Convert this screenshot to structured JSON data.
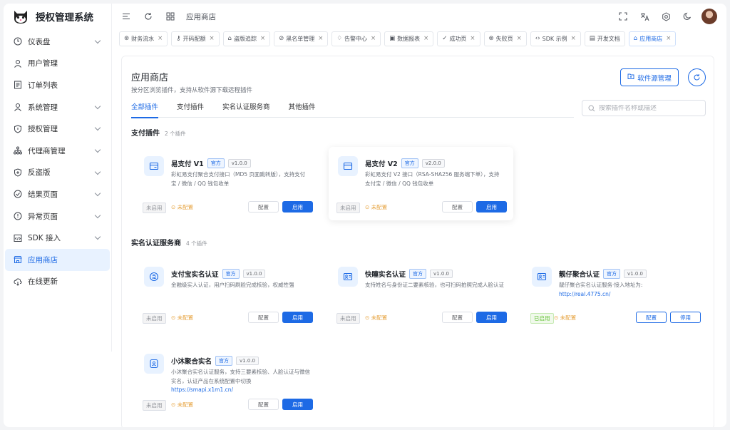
{
  "app": {
    "title": "授权管理系统"
  },
  "sidebar": {
    "items": [
      {
        "label": "仪表盘",
        "icon": "clock-icon",
        "expandable": true
      },
      {
        "label": "用户管理",
        "icon": "user-icon",
        "expandable": false
      },
      {
        "label": "订单列表",
        "icon": "document-icon",
        "expandable": false
      },
      {
        "label": "系统管理",
        "icon": "user-icon",
        "expandable": true
      },
      {
        "label": "授权管理",
        "icon": "shield-icon",
        "expandable": true
      },
      {
        "label": "代理商管理",
        "icon": "org-chart-icon",
        "expandable": true
      },
      {
        "label": "反盗版",
        "icon": "shield-plus-icon",
        "expandable": true
      },
      {
        "label": "结果页面",
        "icon": "check-circle-icon",
        "expandable": true
      },
      {
        "label": "异常页面",
        "icon": "alert-circle-icon",
        "expandable": true
      },
      {
        "label": "SDK 接入",
        "icon": "code-icon",
        "expandable": true
      },
      {
        "label": "应用商店",
        "icon": "store-icon",
        "expandable": false,
        "active": true
      },
      {
        "label": "在线更新",
        "icon": "cloud-download-icon",
        "expandable": false
      }
    ]
  },
  "topbar": {
    "breadcrumb": "应用商店"
  },
  "tabs": [
    {
      "label": "财务流水",
      "icon": "⊛"
    },
    {
      "label": "开码配额",
      "icon": "⚷"
    },
    {
      "label": "盗版追踪",
      "icon": "⌂"
    },
    {
      "label": "黑名单管理",
      "icon": "⊘"
    },
    {
      "label": "告警中心",
      "icon": "♢"
    },
    {
      "label": "数据报表",
      "icon": "▣"
    },
    {
      "label": "成功页",
      "icon": "✓"
    },
    {
      "label": "失败页",
      "icon": "⊗"
    },
    {
      "label": "SDK 示例",
      "icon": "‹›"
    },
    {
      "label": "开发文档",
      "icon": "▤"
    },
    {
      "label": "应用商店",
      "icon": "⌂",
      "active": true
    }
  ],
  "page": {
    "title": "应用商店",
    "subtitle": "按分区浏览插件，支持从软件源下载远程插件",
    "source_button": "软件源管理",
    "search_placeholder": "搜索插件名称或描述"
  },
  "categories": [
    "全部插件",
    "支付插件",
    "实名认证服务商",
    "其他插件"
  ],
  "sections": [
    {
      "title": "支付插件",
      "count": "2 个插件"
    },
    {
      "title": "实名认证服务商",
      "count": "4 个插件"
    }
  ],
  "plugins": [
    {
      "name": "易支付 V1",
      "badge": "官方",
      "version": "v1.0.0",
      "desc": "彩虹易支付聚合支付接口（MD5 页面跳转版），支持支付宝 / 微信 / QQ 钱包收单",
      "link": "",
      "status": "未启用",
      "config_status": "⊙ 未配置",
      "config_btn": "配置",
      "action_btn": "启用",
      "enabled": false
    },
    {
      "name": "易支付 V2",
      "badge": "官方",
      "version": "v2.0.0",
      "desc": "彩虹易支付 V2 接口（RSA-SHA256 服务端下单），支持支付宝 / 微信 / QQ 钱包收单",
      "link": "",
      "status": "未启用",
      "config_status": "⊙ 未配置",
      "config_btn": "配置",
      "action_btn": "启用",
      "enabled": false
    },
    {
      "name": "支付宝实名认证",
      "badge": "官方",
      "version": "v1.0.0",
      "desc": "金融级实人认证，用户扫码刷脸完成核验，权威性强",
      "link": "",
      "status": "未启用",
      "config_status": "⊙ 未配置",
      "config_btn": "配置",
      "action_btn": "启用",
      "enabled": false
    },
    {
      "name": "快瞳实名认证",
      "badge": "官方",
      "version": "v1.0.0",
      "desc": "支持姓名与身份证二要素核验，也可扫码拍照完成人脸认证",
      "link": "",
      "status": "未启用",
      "config_status": "⊙ 未配置",
      "config_btn": "配置",
      "action_btn": "启用",
      "enabled": false
    },
    {
      "name": "靓仔聚合认证",
      "badge": "官方",
      "version": "v1.0.0",
      "desc": "靓仔聚合实名认证服务·接入地址为:",
      "link": "http://real.4775.cn/",
      "status": "已启用",
      "config_status": "⊙ 未配置",
      "config_btn": "配置",
      "action_btn": "停用",
      "enabled": true
    },
    {
      "name": "小沐聚合实名",
      "badge": "官方",
      "version": "v1.0.0",
      "desc": "小沐聚合实名认证服务，支持三要素核验、人脸认证与微信实名，认证产品在系统配置中切换",
      "link": "https://smapi.x1m1.cn/",
      "status": "未启用",
      "config_status": "⊙ 未配置",
      "config_btn": "配置",
      "action_btn": "启用",
      "enabled": false
    }
  ],
  "colors": {
    "accent": "#1d6ae5",
    "warning": "#e6a23c",
    "success": "#67c23a"
  }
}
